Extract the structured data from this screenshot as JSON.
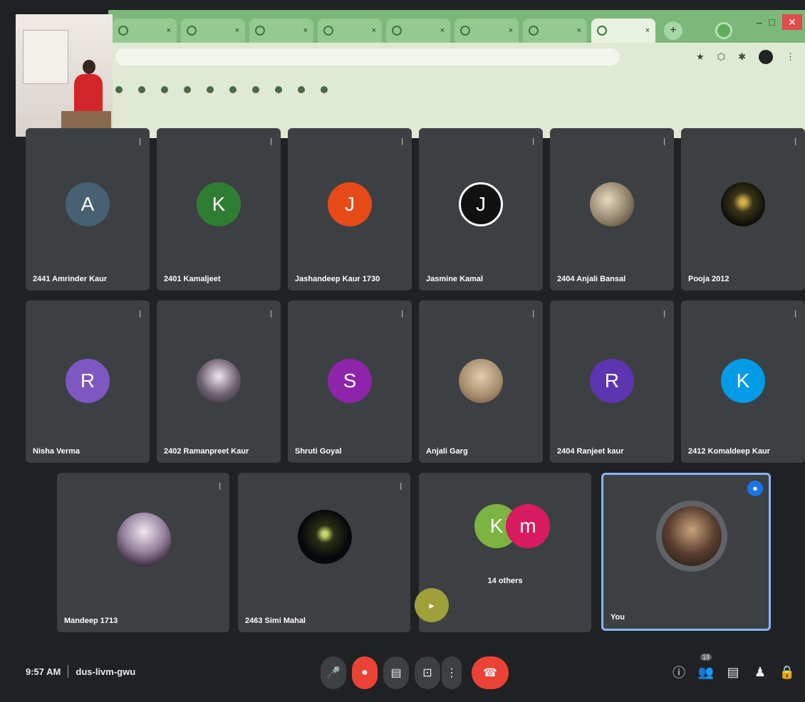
{
  "browser": {
    "tabs": [
      {
        "label": "",
        "active": false
      },
      {
        "label": "",
        "active": false
      },
      {
        "label": "",
        "active": false
      },
      {
        "label": "",
        "active": false
      },
      {
        "label": "",
        "active": false
      },
      {
        "label": "",
        "active": false
      },
      {
        "label": "",
        "active": false
      },
      {
        "label": "",
        "active": true
      }
    ],
    "new_tab": "+",
    "minimize": "–",
    "maximize": "□",
    "close": "✕",
    "url": "",
    "reading_list": "",
    "bookmarks": [
      "",
      "",
      "",
      "",
      "",
      "",
      "",
      "",
      "",
      ""
    ]
  },
  "tiles": [
    {
      "name": "2441 Amrinder Kaur",
      "initial": "A",
      "color": "#456172",
      "photo": false
    },
    {
      "name": "2401 Kamaljeet",
      "initial": "K",
      "color": "#2e7d32",
      "photo": false
    },
    {
      "name": "Jashandeep Kaur 1730",
      "initial": "J",
      "color": "#e64a19",
      "photo": false
    },
    {
      "name": "Jasmine Kamal",
      "initial": "J",
      "color": "#111111",
      "photo": false
    },
    {
      "name": "2404 Anjali Bansal",
      "initial": "",
      "color": "#8a7a64",
      "photo": true
    },
    {
      "name": "Pooja 2012",
      "initial": "",
      "color": "#1a1a10",
      "photo": true
    },
    {
      "name": "Nisha Verma",
      "initial": "R",
      "color": "#7e57c2",
      "photo": false
    },
    {
      "name": "2402 Ramanpreet Kaur",
      "initial": "",
      "color": "#6b5f6c",
      "photo": true
    },
    {
      "name": "Shruti Goyal",
      "initial": "S",
      "color": "#8e24aa",
      "photo": false
    },
    {
      "name": "Anjali Garg",
      "initial": "",
      "color": "#a58a6a",
      "photo": true
    },
    {
      "name": "2404 Ranjeet kaur",
      "initial": "R",
      "color": "#5e35b1",
      "photo": false
    },
    {
      "name": "2412 Komaldeep Kaur",
      "initial": "K",
      "color": "#039be5",
      "photo": false
    },
    {
      "name": "Mandeep 1713",
      "initial": "",
      "color": "#7a6a7c",
      "photo": true
    },
    {
      "name": "2463 Simi Mahal",
      "initial": "",
      "color": "#0b0f08",
      "photo": true
    },
    {
      "name": "14 others",
      "initial": "",
      "color": "",
      "photo": false
    },
    {
      "name": "You",
      "initial": "",
      "color": "#3a2a22",
      "photo": true
    }
  ],
  "others_avatars": [
    {
      "initial": "K",
      "color": "#7cb342"
    },
    {
      "initial": "m",
      "color": "#d81b60"
    }
  ],
  "meeting": {
    "time": "9:57 AM",
    "code": "dus-livm-gwu"
  },
  "icons": {
    "mic": "🎤",
    "camera": "●",
    "captions": "▤",
    "present": "⊡",
    "more": "⋮",
    "end_call": "☎",
    "info": "ⓘ",
    "people": "👥",
    "chat": "▤",
    "activities": "♟",
    "lock": "🔒",
    "tile_mic": "⦚",
    "pin": "📌"
  },
  "people_count": "19"
}
